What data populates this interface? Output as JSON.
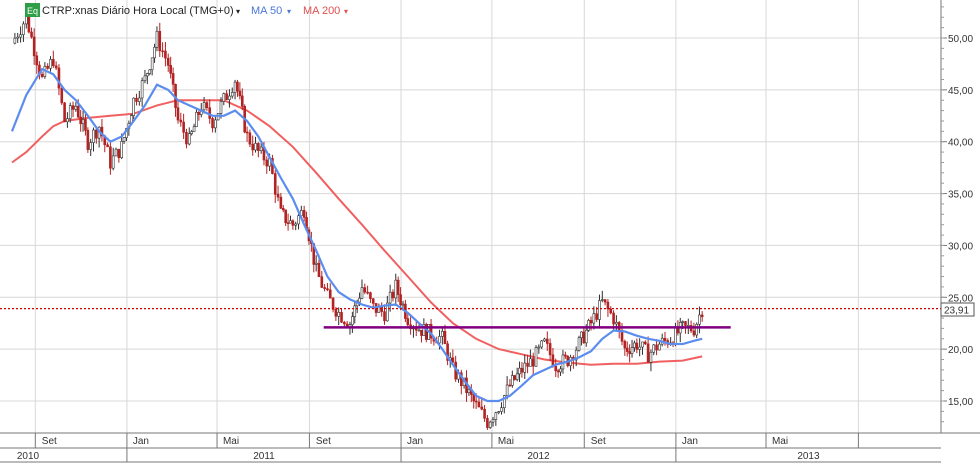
{
  "header": {
    "badge": "Eq",
    "symbol": "CTRP:xnas Diário Hora Local (TMG+0)",
    "ma50_label": "MA 50",
    "ma200_label": "MA 200"
  },
  "colors": {
    "background": "#ffffff",
    "grid": "#d8d8d8",
    "candle_up": "#2f2f2f",
    "candle_down": "#b22222",
    "ma50": "#5b8def",
    "ma200": "#f06060",
    "support_line": "#800080",
    "last_price_line": "#cc0000",
    "badge": "#2e9e47"
  },
  "chart_data": {
    "type": "candlestick",
    "y_ticks": [
      "15,00",
      "20,00",
      "25,00",
      "30,00",
      "35,00",
      "40,00",
      "45,00",
      "50,00"
    ],
    "ylim": [
      11,
      52
    ],
    "x_month_labels": [
      "Set",
      "Jan",
      "Mai",
      "Set",
      "Jan",
      "Mai",
      "Set",
      "Jan",
      "Mai"
    ],
    "x_year_labels": [
      "2010",
      "2011",
      "2012",
      "2013"
    ],
    "last_price": 23.91,
    "last_price_label": "23,91",
    "support_level": 22.1,
    "price_path": [
      [
        "2010-08-01",
        49.5
      ],
      [
        "2010-08-20",
        52.0
      ],
      [
        "2010-09-10",
        46.0
      ],
      [
        "2010-09-25",
        48.0
      ],
      [
        "2010-10-10",
        42.0
      ],
      [
        "2010-10-25",
        43.5
      ],
      [
        "2010-11-10",
        40.0
      ],
      [
        "2010-11-25",
        41.5
      ],
      [
        "2010-12-10",
        38.0
      ],
      [
        "2010-12-25",
        39.5
      ],
      [
        "2011-01-10",
        44.0
      ],
      [
        "2011-01-25",
        46.0
      ],
      [
        "2011-02-10",
        50.0
      ],
      [
        "2011-02-25",
        47.5
      ],
      [
        "2011-03-10",
        42.0
      ],
      [
        "2011-03-25",
        40.0
      ],
      [
        "2011-04-10",
        43.5
      ],
      [
        "2011-04-25",
        42.0
      ],
      [
        "2011-05-10",
        44.0
      ],
      [
        "2011-05-25",
        46.0
      ],
      [
        "2011-06-10",
        40.5
      ],
      [
        "2011-06-25",
        39.0
      ],
      [
        "2011-07-10",
        38.0
      ],
      [
        "2011-07-25",
        33.0
      ],
      [
        "2011-08-10",
        32.0
      ],
      [
        "2011-08-25",
        33.5
      ],
      [
        "2011-09-10",
        27.5
      ],
      [
        "2011-09-25",
        25.0
      ],
      [
        "2011-10-10",
        23.5
      ],
      [
        "2011-10-25",
        22.5
      ],
      [
        "2011-11-10",
        26.0
      ],
      [
        "2011-11-25",
        24.0
      ],
      [
        "2011-12-10",
        23.5
      ],
      [
        "2011-12-25",
        26.0
      ],
      [
        "2012-01-10",
        23.0
      ],
      [
        "2012-01-25",
        22.0
      ],
      [
        "2012-02-10",
        21.5
      ],
      [
        "2012-02-25",
        21.0
      ],
      [
        "2012-03-10",
        18.0
      ],
      [
        "2012-03-25",
        16.5
      ],
      [
        "2012-04-10",
        14.5
      ],
      [
        "2012-04-25",
        13.0
      ],
      [
        "2012-05-10",
        14.5
      ],
      [
        "2012-05-25",
        16.5
      ],
      [
        "2012-06-10",
        18.0
      ],
      [
        "2012-06-25",
        19.0
      ],
      [
        "2012-07-10",
        20.5
      ],
      [
        "2012-07-25",
        18.5
      ],
      [
        "2012-08-10",
        19.0
      ],
      [
        "2012-08-25",
        20.5
      ],
      [
        "2012-09-10",
        22.5
      ],
      [
        "2012-09-25",
        24.5
      ],
      [
        "2012-10-10",
        23.0
      ],
      [
        "2012-10-25",
        20.0
      ],
      [
        "2012-11-10",
        20.5
      ],
      [
        "2012-11-25",
        19.5
      ],
      [
        "2012-12-10",
        20.5
      ],
      [
        "2012-12-25",
        21.0
      ],
      [
        "2013-01-10",
        22.0
      ],
      [
        "2013-01-25",
        22.0
      ],
      [
        "2013-02-05",
        23.91
      ]
    ],
    "ma50_path": [
      [
        "2010-08-01",
        41.0
      ],
      [
        "2010-08-20",
        44.5
      ],
      [
        "2010-09-10",
        47.0
      ],
      [
        "2010-09-25",
        46.5
      ],
      [
        "2010-10-10",
        45.0
      ],
      [
        "2010-10-25",
        44.0
      ],
      [
        "2010-11-10",
        42.5
      ],
      [
        "2010-11-25",
        41.0
      ],
      [
        "2010-12-10",
        40.0
      ],
      [
        "2010-12-25",
        40.5
      ],
      [
        "2011-01-10",
        42.0
      ],
      [
        "2011-01-25",
        43.5
      ],
      [
        "2011-02-10",
        45.5
      ],
      [
        "2011-02-25",
        45.0
      ],
      [
        "2011-03-10",
        44.0
      ],
      [
        "2011-03-25",
        43.5
      ],
      [
        "2011-04-10",
        43.0
      ],
      [
        "2011-04-25",
        42.5
      ],
      [
        "2011-05-10",
        42.5
      ],
      [
        "2011-05-25",
        43.0
      ],
      [
        "2011-06-10",
        42.0
      ],
      [
        "2011-06-25",
        40.5
      ],
      [
        "2011-07-10",
        38.5
      ],
      [
        "2011-07-25",
        36.5
      ],
      [
        "2011-08-10",
        34.5
      ],
      [
        "2011-08-25",
        32.0
      ],
      [
        "2011-09-10",
        29.5
      ],
      [
        "2011-09-25",
        27.0
      ],
      [
        "2011-10-10",
        25.5
      ],
      [
        "2011-10-25",
        24.8
      ],
      [
        "2011-11-10",
        24.3
      ],
      [
        "2011-11-25",
        24.0
      ],
      [
        "2011-12-10",
        24.2
      ],
      [
        "2011-12-25",
        24.3
      ],
      [
        "2012-01-10",
        23.5
      ],
      [
        "2012-01-25",
        22.5
      ],
      [
        "2012-02-10",
        21.5
      ],
      [
        "2012-02-25",
        20.0
      ],
      [
        "2012-03-10",
        18.5
      ],
      [
        "2012-03-25",
        17.0
      ],
      [
        "2012-04-10",
        15.5
      ],
      [
        "2012-04-25",
        15.0
      ],
      [
        "2012-05-10",
        15.0
      ],
      [
        "2012-05-25",
        15.5
      ],
      [
        "2012-06-10",
        16.5
      ],
      [
        "2012-06-25",
        17.5
      ],
      [
        "2012-07-10",
        18.0
      ],
      [
        "2012-07-25",
        18.5
      ],
      [
        "2012-08-10",
        18.8
      ],
      [
        "2012-08-25",
        19.2
      ],
      [
        "2012-09-10",
        19.8
      ],
      [
        "2012-09-25",
        21.0
      ],
      [
        "2012-10-10",
        21.8
      ],
      [
        "2012-10-25",
        21.7
      ],
      [
        "2012-11-10",
        21.3
      ],
      [
        "2012-11-25",
        21.0
      ],
      [
        "2012-12-10",
        20.8
      ],
      [
        "2012-12-25",
        20.5
      ],
      [
        "2013-01-10",
        20.5
      ],
      [
        "2013-01-25",
        20.8
      ],
      [
        "2013-02-05",
        21.0
      ]
    ],
    "ma200_path": [
      [
        "2010-08-01",
        38.0
      ],
      [
        "2010-08-20",
        39.0
      ],
      [
        "2010-09-10",
        40.5
      ],
      [
        "2010-09-25",
        41.5
      ],
      [
        "2010-10-10",
        42.0
      ],
      [
        "2010-11-10",
        42.3
      ],
      [
        "2010-12-10",
        42.5
      ],
      [
        "2011-01-10",
        42.7
      ],
      [
        "2011-02-10",
        43.5
      ],
      [
        "2011-03-10",
        44.0
      ],
      [
        "2011-04-10",
        44.0
      ],
      [
        "2011-05-10",
        44.0
      ],
      [
        "2011-06-10",
        43.0
      ],
      [
        "2011-07-10",
        41.5
      ],
      [
        "2011-08-10",
        39.5
      ],
      [
        "2011-09-10",
        37.0
      ],
      [
        "2011-10-10",
        34.5
      ],
      [
        "2011-11-10",
        32.0
      ],
      [
        "2011-12-10",
        29.5
      ],
      [
        "2012-01-10",
        27.0
      ],
      [
        "2012-02-10",
        24.5
      ],
      [
        "2012-03-10",
        22.5
      ],
      [
        "2012-04-10",
        21.0
      ],
      [
        "2012-05-10",
        20.0
      ],
      [
        "2012-06-10",
        19.5
      ],
      [
        "2012-07-10",
        19.0
      ],
      [
        "2012-08-10",
        18.7
      ],
      [
        "2012-09-10",
        18.5
      ],
      [
        "2012-10-10",
        18.6
      ],
      [
        "2012-11-10",
        18.6
      ],
      [
        "2012-12-10",
        18.8
      ],
      [
        "2013-01-10",
        18.9
      ],
      [
        "2013-02-05",
        19.3
      ]
    ],
    "support_line_range": [
      "2011-09-20",
      "2013-03-15"
    ]
  }
}
